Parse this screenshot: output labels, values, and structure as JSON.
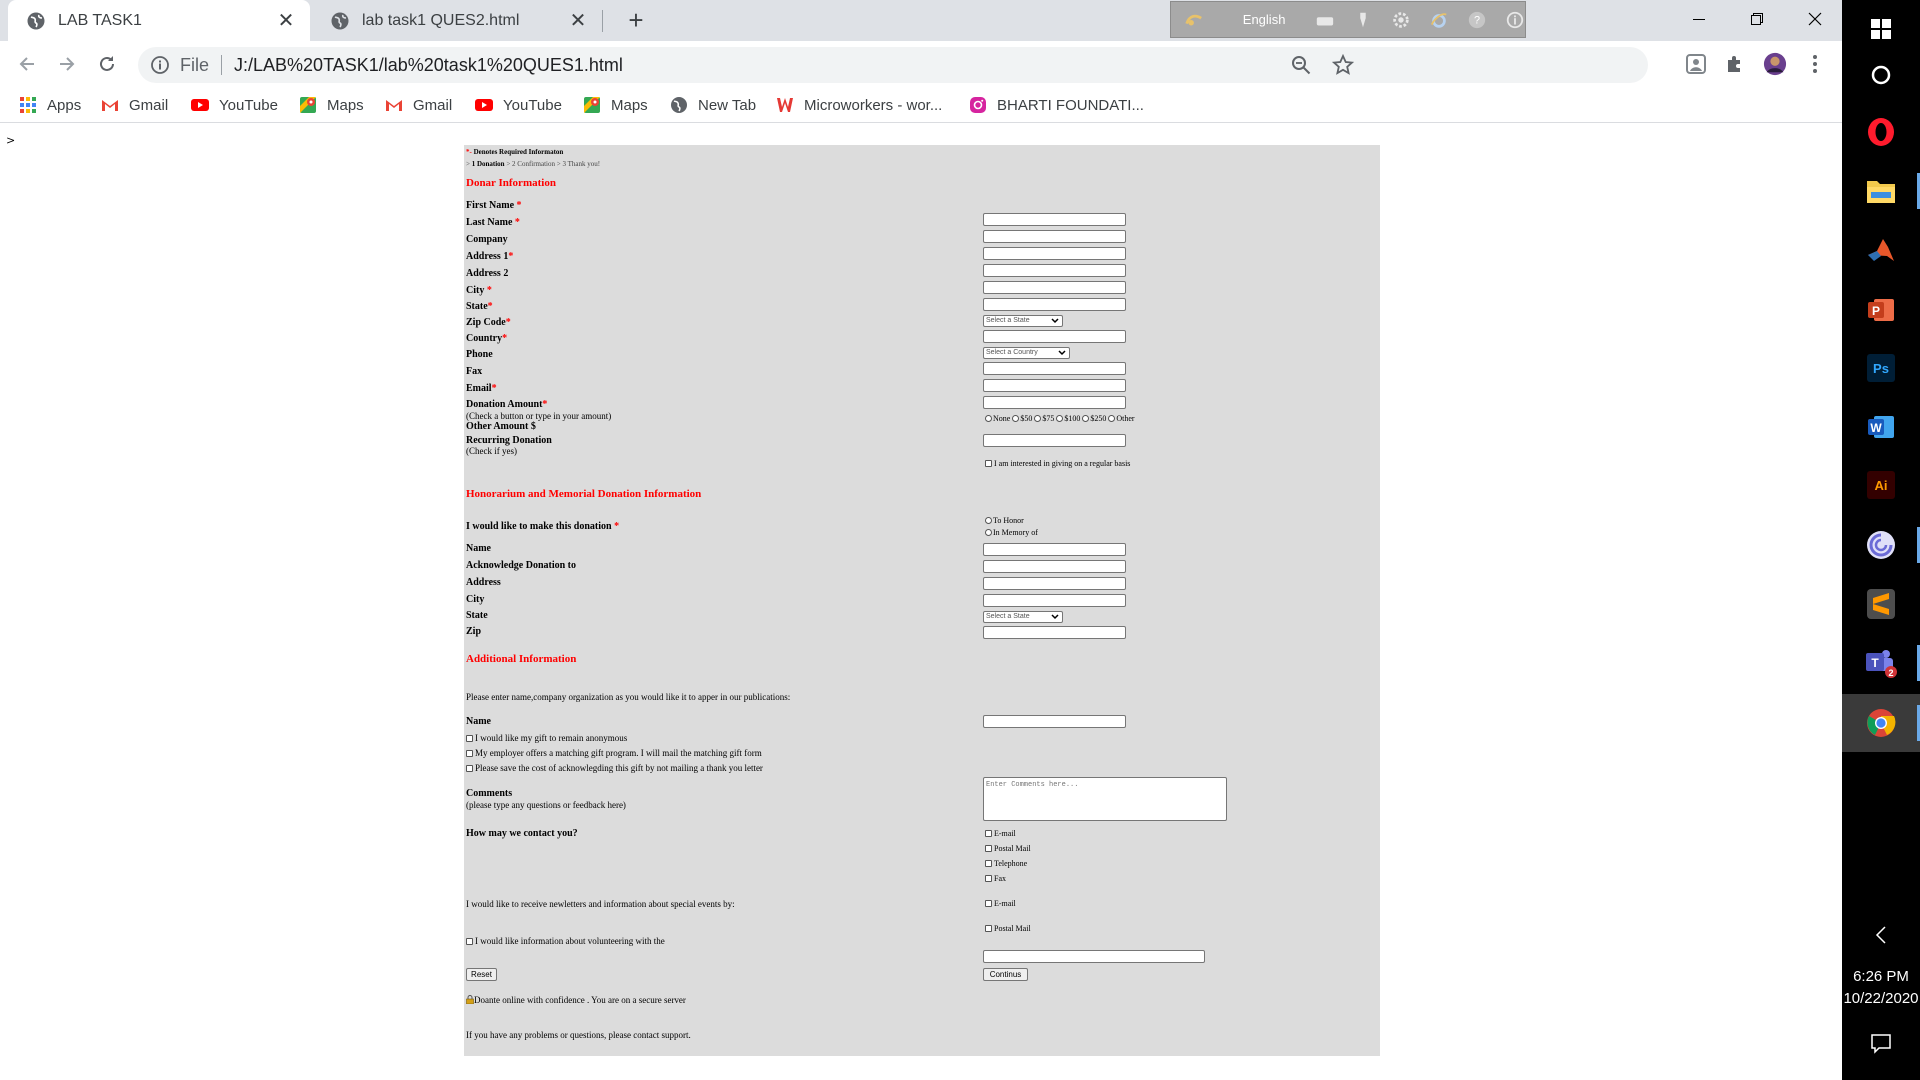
{
  "browser": {
    "tabs": [
      {
        "label": "LAB TASK1",
        "active": true
      },
      {
        "label": "lab task1 QUES2.html",
        "active": false
      }
    ],
    "language_bar": {
      "label": "English"
    },
    "address": {
      "scheme": "File",
      "url": "J:/LAB%20TASK1/lab%20task1%20QUES1.html"
    },
    "bookmarks": [
      {
        "label": "Apps",
        "icon": "apps-grid-icon"
      },
      {
        "label": "Gmail",
        "icon": "gmail-icon"
      },
      {
        "label": "YouTube",
        "icon": "youtube-icon"
      },
      {
        "label": "Maps",
        "icon": "maps-icon"
      },
      {
        "label": "Gmail",
        "icon": "gmail-icon"
      },
      {
        "label": "YouTube",
        "icon": "youtube-icon"
      },
      {
        "label": "Maps",
        "icon": "maps-icon"
      },
      {
        "label": "New Tab",
        "icon": "globe-icon"
      },
      {
        "label": "Microworkers - wor...",
        "icon": "microworkers-icon"
      },
      {
        "label": "BHARTI FOUNDATI...",
        "icon": "instagram-icon"
      }
    ],
    "colors": {
      "tabstrip": "#dee1e6",
      "omnibox": "#f1f3f4"
    }
  },
  "page": {
    "caret": ">",
    "required_note": {
      "mark": "*-",
      "text": " Denotes Required Informaton"
    },
    "steps": {
      "arrow": "> ",
      "current": "1 Donation",
      "rest": " > 2 Confirmation > 3 Thank you!"
    },
    "donor": {
      "heading": "Donar Information",
      "fields": {
        "first_name": "First Name",
        "last_name": "Last Name",
        "company": "Company",
        "address1": "Address 1",
        "address2": "Address 2",
        "city": "City",
        "state": "State",
        "zip": "Zip Code",
        "country": "Country",
        "phone": "Phone",
        "fax": "Fax",
        "email": "Email"
      },
      "state_select": "Select a State",
      "country_select": "Select a Country",
      "donation_amount": "Donation Amount",
      "donation_hint": "(Check a button or type in your amount)",
      "amount_options": [
        "None",
        "$50",
        "$75",
        "$100",
        "$250",
        "Other"
      ],
      "other_amount": "Other Amount $",
      "recurring": "Recurring Donation",
      "recurring_hint": "(Check if yes)",
      "recurring_option": "I am interested in giving on a regular basis"
    },
    "honorarium": {
      "heading": "Honorarium and Memorial Donation Information",
      "make_donation": "I would like to make this donation",
      "honor_options": [
        "To Honor",
        "In Memory of"
      ],
      "name": "Name",
      "acknowledge": "Acknowledge Donation to",
      "address": "Address",
      "city": "City",
      "state": "State",
      "state_select": "Select a State",
      "zip": "Zip"
    },
    "additional": {
      "heading": "Additional Information",
      "instruction": "Please enter name,company organization as you would like it to apper in our publications:",
      "name": "Name",
      "checks": [
        "I would like my gift to remain anonymous",
        "My employer offers a matching gift program. I will mail the matching gift form",
        "Please save the cost of acknowlegding this gift by not mailing a thank you letter"
      ],
      "comments": "Comments",
      "comments_hint": "(please type any questions or feedback here)",
      "comments_placeholder": "Enter Comments here...",
      "contact_question": "How may we contact you?",
      "contact_options": [
        "E-mail",
        "Postal Mail",
        "Telephone",
        "Fax"
      ],
      "newsletter": "I would like to receive newletters and information about special events by:",
      "newsletter_options": [
        "E-mail",
        "Postal Mail"
      ],
      "volunteer": "I would like information about volunteering with the",
      "reset": "Reset",
      "continue": "Continus",
      "secure": "Doante online with confidence . You are on a secure server",
      "support": "If you have any problems or questions, please contact support."
    },
    "colors": {
      "form_bg": "#dcdcdc",
      "heading": "#ff0000"
    }
  },
  "taskbar": {
    "apps": [
      "cortana-icon",
      "opera-icon",
      "file-explorer-icon",
      "matlab-icon",
      "powerpoint-icon",
      "photoshop-icon",
      "word-icon",
      "illustrator-icon",
      "bittorrent-icon",
      "sublime-text-icon",
      "teams-icon",
      "chrome-icon"
    ],
    "teams_badge": "2",
    "time": "6:26 PM",
    "date": "10/22/2020"
  }
}
